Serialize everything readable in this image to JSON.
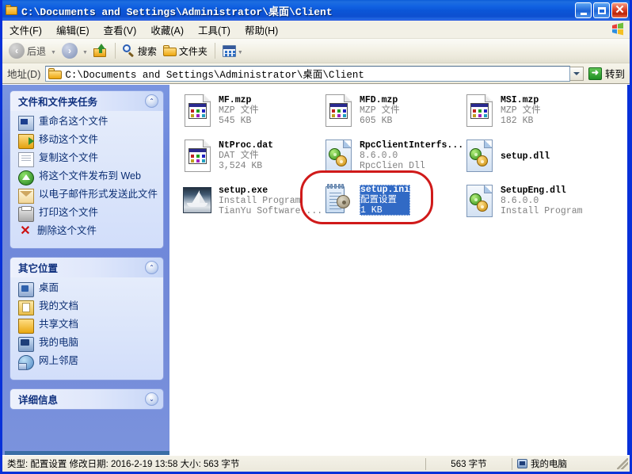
{
  "window": {
    "title": "C:\\Documents and Settings\\Administrator\\桌面\\Client",
    "title_icon": "folder-icon",
    "minimize_label": "最小化",
    "maximize_label": "最大化",
    "close_label": "×"
  },
  "menubar": {
    "items": [
      {
        "label": "文件(F)"
      },
      {
        "label": "编辑(E)"
      },
      {
        "label": "查看(V)"
      },
      {
        "label": "收藏(A)"
      },
      {
        "label": "工具(T)"
      },
      {
        "label": "帮助(H)"
      }
    ],
    "brand_icon": "windows-flag-icon"
  },
  "toolbar": {
    "back_label": "后退",
    "back_icon": "arrow-left-icon",
    "forward_icon": "arrow-right-icon",
    "up_icon": "folder-up-icon",
    "search_label": "搜索",
    "search_icon": "magnifier-icon",
    "folders_label": "文件夹",
    "folders_icon": "folder-icon",
    "views_icon": "views-icon",
    "dropdown_caret": "▾"
  },
  "address": {
    "label": "地址(D)",
    "icon": "folder-icon",
    "value": "C:\\Documents and Settings\\Administrator\\桌面\\Client",
    "dropdown_icon": "chevron-down-icon",
    "go_label": "转到",
    "go_icon": "arrow-right-green-icon"
  },
  "sidebar": {
    "panels": [
      {
        "title": "文件和文件夹任务",
        "toggle": "collapse-icon",
        "toggle_glyph": "⌃",
        "items": [
          {
            "label": "重命名这个文件",
            "icon": "rename-file-icon"
          },
          {
            "label": "移动这个文件",
            "icon": "move-file-icon"
          },
          {
            "label": "复制这个文件",
            "icon": "copy-file-icon"
          },
          {
            "label": "将这个文件发布到 Web",
            "icon": "publish-web-icon"
          },
          {
            "label": "以电子邮件形式发送此文件",
            "icon": "email-file-icon"
          },
          {
            "label": "打印这个文件",
            "icon": "print-file-icon"
          },
          {
            "label": "删除这个文件",
            "icon": "delete-file-icon"
          }
        ]
      },
      {
        "title": "其它位置",
        "toggle": "collapse-icon",
        "toggle_glyph": "⌃",
        "items": [
          {
            "label": "桌面",
            "icon": "desktop-icon"
          },
          {
            "label": "我的文档",
            "icon": "my-documents-icon"
          },
          {
            "label": "共享文档",
            "icon": "shared-documents-icon"
          },
          {
            "label": "我的电脑",
            "icon": "my-computer-icon"
          },
          {
            "label": "网上邻居",
            "icon": "network-neighborhood-icon"
          }
        ]
      },
      {
        "title": "详细信息",
        "toggle": "expand-icon",
        "toggle_glyph": "⌄",
        "items": []
      }
    ]
  },
  "files": [
    {
      "name": "MF.mzp",
      "line2": "MZP 文件",
      "line3": "545 KB",
      "icon": "mzp-file-icon",
      "selected": false
    },
    {
      "name": "MFD.mzp",
      "line2": "MZP 文件",
      "line3": "605 KB",
      "icon": "mzp-file-icon",
      "selected": false
    },
    {
      "name": "MSI.mzp",
      "line2": "MZP 文件",
      "line3": "182 KB",
      "icon": "mzp-file-icon",
      "selected": false
    },
    {
      "name": "NtProc.dat",
      "line2": "DAT 文件",
      "line3": "3,524 KB",
      "icon": "dat-file-icon",
      "selected": false
    },
    {
      "name": "RpcClientInterfs...",
      "line2": "8.6.0.0",
      "line3": "RpcClien Dll",
      "icon": "dll-file-icon",
      "selected": false
    },
    {
      "name": "setup.dll",
      "line2": "",
      "line3": "",
      "icon": "dll-file-icon",
      "selected": false
    },
    {
      "name": "setup.exe",
      "line2": "Install Program",
      "line3": "TianYu Software ...",
      "icon": "exe-file-icon",
      "selected": false
    },
    {
      "name": "setup.ini",
      "line2": "配置设置",
      "line3": "1 KB",
      "icon": "ini-file-icon",
      "selected": true
    },
    {
      "name": "SetupEng.dll",
      "line2": "8.6.0.0",
      "line3": "Install Program",
      "icon": "dll-file-icon",
      "selected": false
    }
  ],
  "annotation": {
    "shape": "red-ellipse-highlight",
    "color": "#d01a1a",
    "targets": "setup.ini"
  },
  "statusbar": {
    "details": "类型: 配置设置 修改日期: 2016-2-19 13:58 大小: 563 字节",
    "size": "563 字节",
    "location": "我的电脑",
    "location_icon": "my-computer-icon"
  }
}
